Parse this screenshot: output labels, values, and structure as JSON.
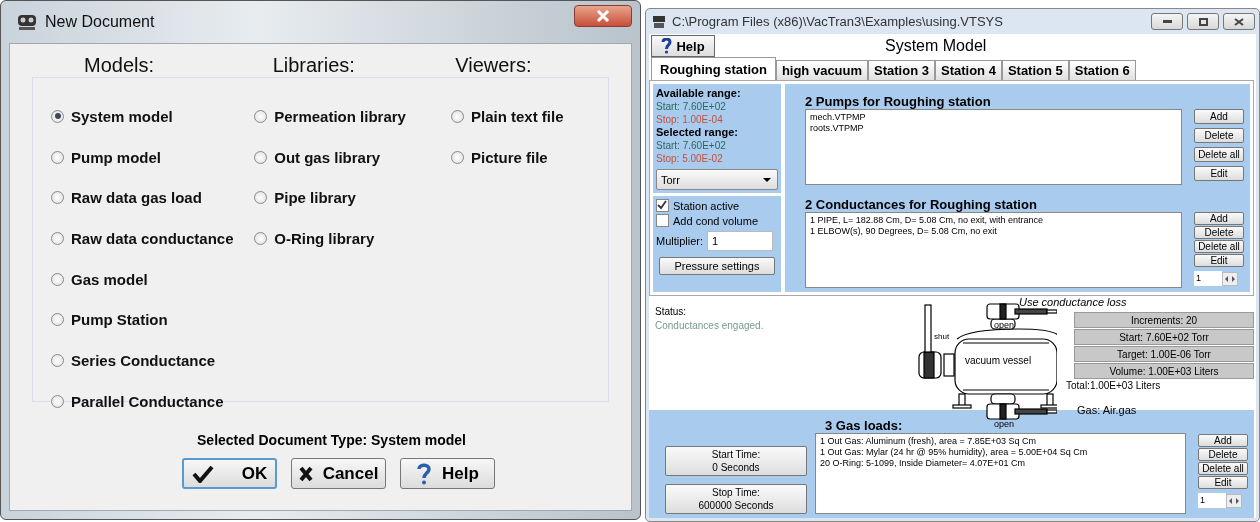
{
  "dialog": {
    "title": "New Document",
    "sections": [
      {
        "heading": "Models:",
        "options": [
          {
            "label": "System model",
            "selected": true
          },
          {
            "label": "Pump model",
            "selected": false
          },
          {
            "label": "Raw data gas load",
            "selected": false
          },
          {
            "label": "Raw data conductance",
            "selected": false
          },
          {
            "label": "Gas model",
            "selected": false
          },
          {
            "label": "Pump Station",
            "selected": false
          },
          {
            "label": "Series Conductance",
            "selected": false
          },
          {
            "label": "Parallel Conductance",
            "selected": false
          }
        ]
      },
      {
        "heading": "Libraries:",
        "options": [
          {
            "label": "Permeation library",
            "selected": false
          },
          {
            "label": "Out gas library",
            "selected": false
          },
          {
            "label": "Pipe library",
            "selected": false
          },
          {
            "label": "O-Ring library",
            "selected": false
          }
        ]
      },
      {
        "heading": "Viewers:",
        "options": [
          {
            "label": "Plain text file",
            "selected": false
          },
          {
            "label": "Picture file",
            "selected": false
          }
        ]
      }
    ],
    "selected_type": "Selected Document Type: System model",
    "buttons": [
      {
        "kind": "ok",
        "label": "OK"
      },
      {
        "kind": "cancel",
        "label": "Cancel"
      },
      {
        "kind": "help",
        "label": "Help"
      }
    ]
  },
  "main": {
    "title": "C:\\Program Files (x86)\\VacTran3\\Examples\\using.VTSYS",
    "help_button": "Help",
    "heading": "System Model",
    "tabs": [
      {
        "label": "Roughing station",
        "selected": true
      },
      {
        "label": "high vacuum",
        "selected": false
      },
      {
        "label": "Station 3",
        "selected": false
      },
      {
        "label": "Station 4",
        "selected": false
      },
      {
        "label": "Station 5",
        "selected": false
      },
      {
        "label": "Station 6",
        "selected": false
      }
    ],
    "ranges": [
      {
        "kind": "heading",
        "text": "Available range:"
      },
      {
        "kind": "start",
        "text": "Start:  7.60E+02"
      },
      {
        "kind": "stop",
        "text": "Stop: 1.00E-04"
      },
      {
        "kind": "heading",
        "text": "Selected range:"
      },
      {
        "kind": "start",
        "text": "Start:  7.60E+02"
      },
      {
        "kind": "stop",
        "text": "Stop: 5.00E-02"
      }
    ],
    "unit": "Torr",
    "checkboxes": [
      {
        "label": "Station active",
        "checked": true
      },
      {
        "label": "Add cond volume",
        "checked": false
      }
    ],
    "multiplier": {
      "label": "Multiplier:",
      "value": "1"
    },
    "pressure_button": "Pressure settings",
    "pumps": {
      "title": "2 Pumps for Roughing station",
      "items": [
        "mech.VTPMP",
        "roots.VTPMP"
      ],
      "buttons": [
        "Add",
        "Delete",
        "Delete all",
        "Edit"
      ]
    },
    "conductances": {
      "title": "2 Conductances for Roughing station",
      "items": [
        "1 PIPE, L= 182.88 Cm, D= 5.08 Cm, no exit, with entrance",
        "1 ELBOW(s), 90 Degrees, D= 5.08 Cm, no exit"
      ],
      "buttons": [
        "Add",
        "Delete",
        "Delete all",
        "Edit"
      ],
      "spinner": "1"
    },
    "status": {
      "label": "Status:",
      "text": "Conductances engaged."
    },
    "schematic": {
      "note": "Use conductance loss",
      "top_valve": "open",
      "side_valve": "shut",
      "vessel": "vacuum vessel",
      "bottom_valve": "open",
      "gas": "Gas: Air.gas"
    },
    "info_buttons": [
      "Increments: 20",
      "Start: 7.60E+02 Torr",
      "Target: 1.00E-06 Torr",
      "Volume: 1.00E+03 Liters"
    ],
    "total": "Total:1.00E+03 Liters",
    "gas_loads": {
      "title": "3 Gas loads:",
      "time_buttons": [
        {
          "label": "Start Time:",
          "value": "0 Seconds"
        },
        {
          "label": "Stop Time:",
          "value": "600000 Seconds"
        }
      ],
      "items": [
        "1 Out Gas: Aluminum (fresh), area = 7.85E+03 Sq Cm",
        "1 Out Gas: Mylar (24 hr @ 95% humidity), area = 5.00E+04 Sq Cm",
        "20 O-Ring: 5-1099, Inside Diameter= 4.07E+01 Cm"
      ],
      "buttons": [
        "Add",
        "Delete",
        "Delete all",
        "Edit"
      ],
      "spinner": "1"
    }
  }
}
